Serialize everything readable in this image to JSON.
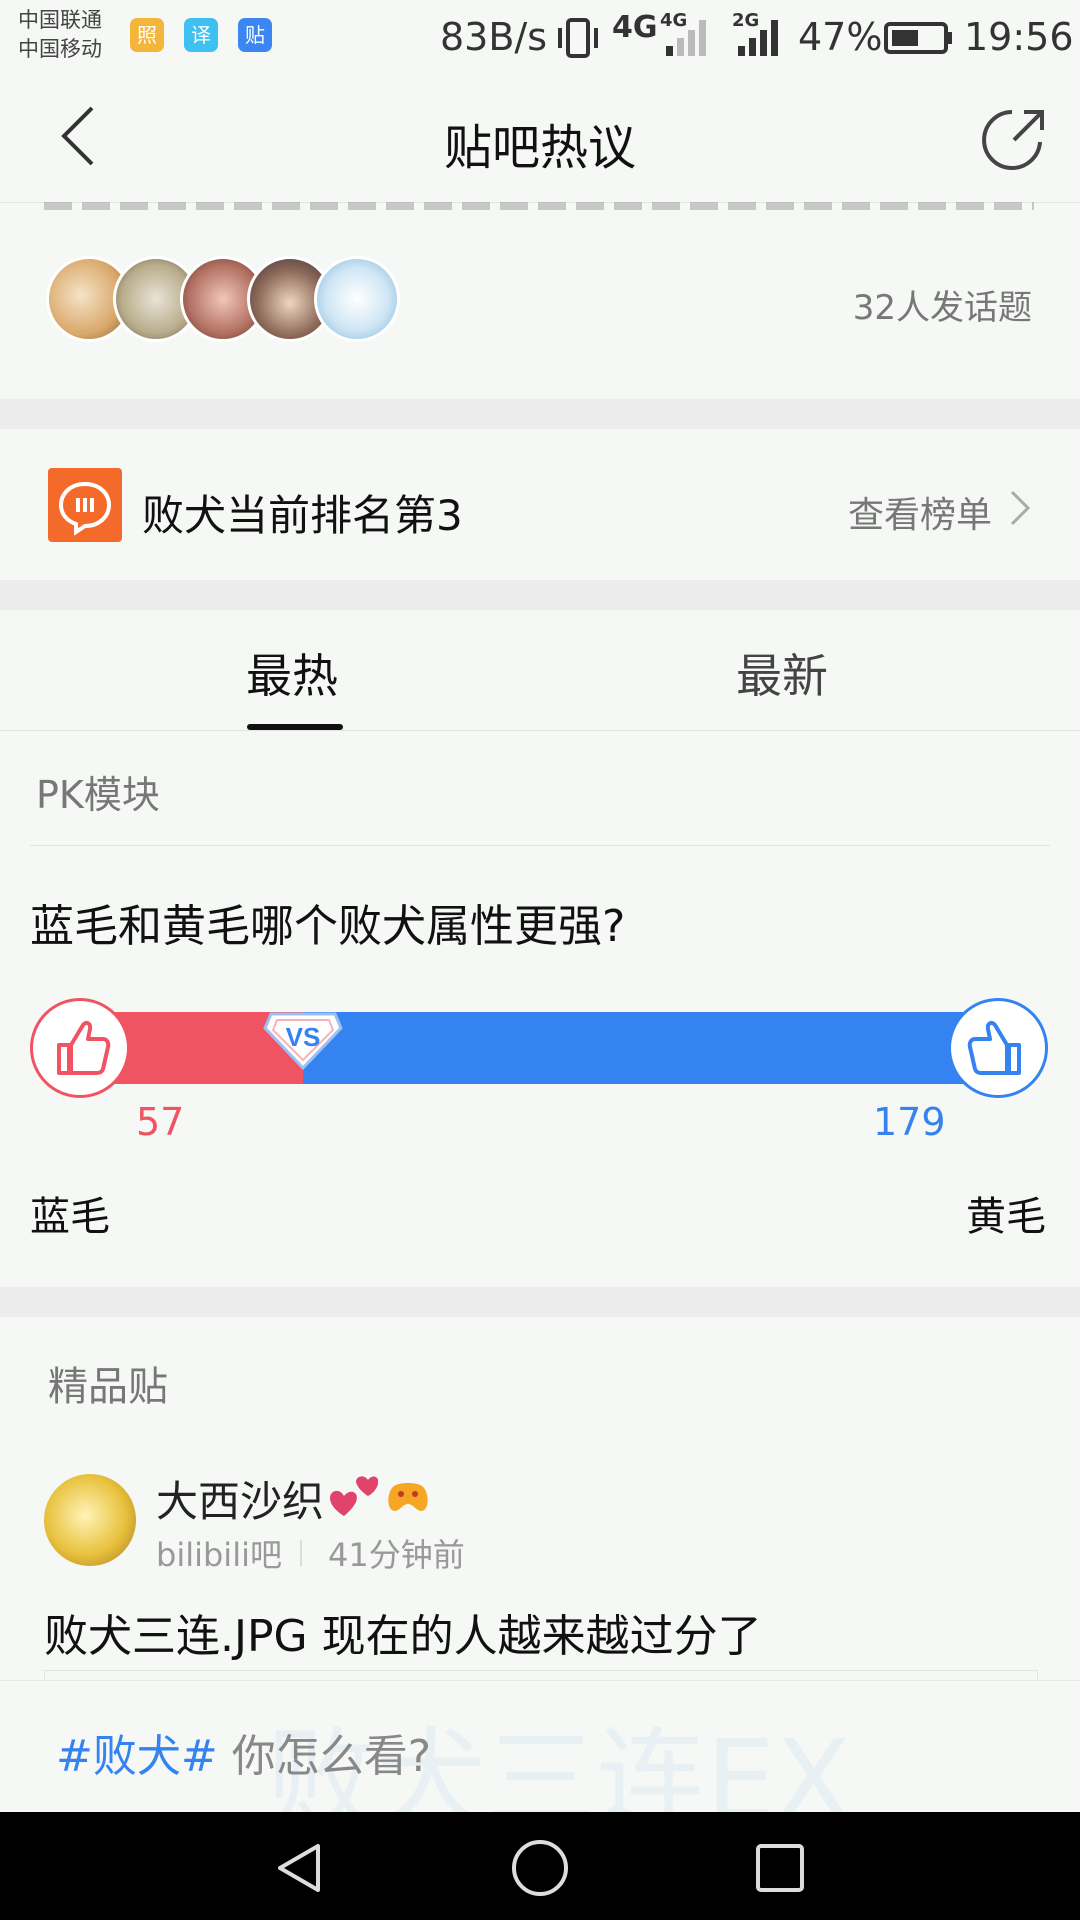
{
  "status": {
    "carrier1": "中国联通",
    "carrier2": "中国移动",
    "apps": [
      "照",
      "译",
      "贴"
    ],
    "net_speed": "83B/s",
    "sig1": "4G",
    "sig2": "4G",
    "sig3": "2G",
    "battery": "47%",
    "time": "19:56"
  },
  "header": {
    "title": "贴吧热议"
  },
  "topic": {
    "cutoff_text": "…",
    "participants": "32人发话题"
  },
  "rank": {
    "text": "败犬当前排名第3",
    "link": "查看榜单"
  },
  "tabs": [
    {
      "label": "最热"
    },
    {
      "label": "最新"
    }
  ],
  "pk": {
    "section_title": "PK模块",
    "question": "蓝毛和黄毛哪个败犬属性更强?",
    "vs": "VS",
    "left": {
      "count": "57",
      "label": "蓝毛",
      "color": "#f05462"
    },
    "right": {
      "count": "179",
      "label": "黄毛",
      "color": "#3583f0"
    },
    "left_share": 0.242
  },
  "featured": {
    "section_title": "精品贴",
    "post": {
      "author": "大西沙织",
      "forum": "bilibili吧",
      "time": "41分钟前",
      "title": "败犬三连.JPG 现在的人越来越过分了",
      "image_text": "败犬三连EX"
    }
  },
  "comment_bar": {
    "hashtag": "#败犬#",
    "placeholder": " 你怎么看?"
  }
}
